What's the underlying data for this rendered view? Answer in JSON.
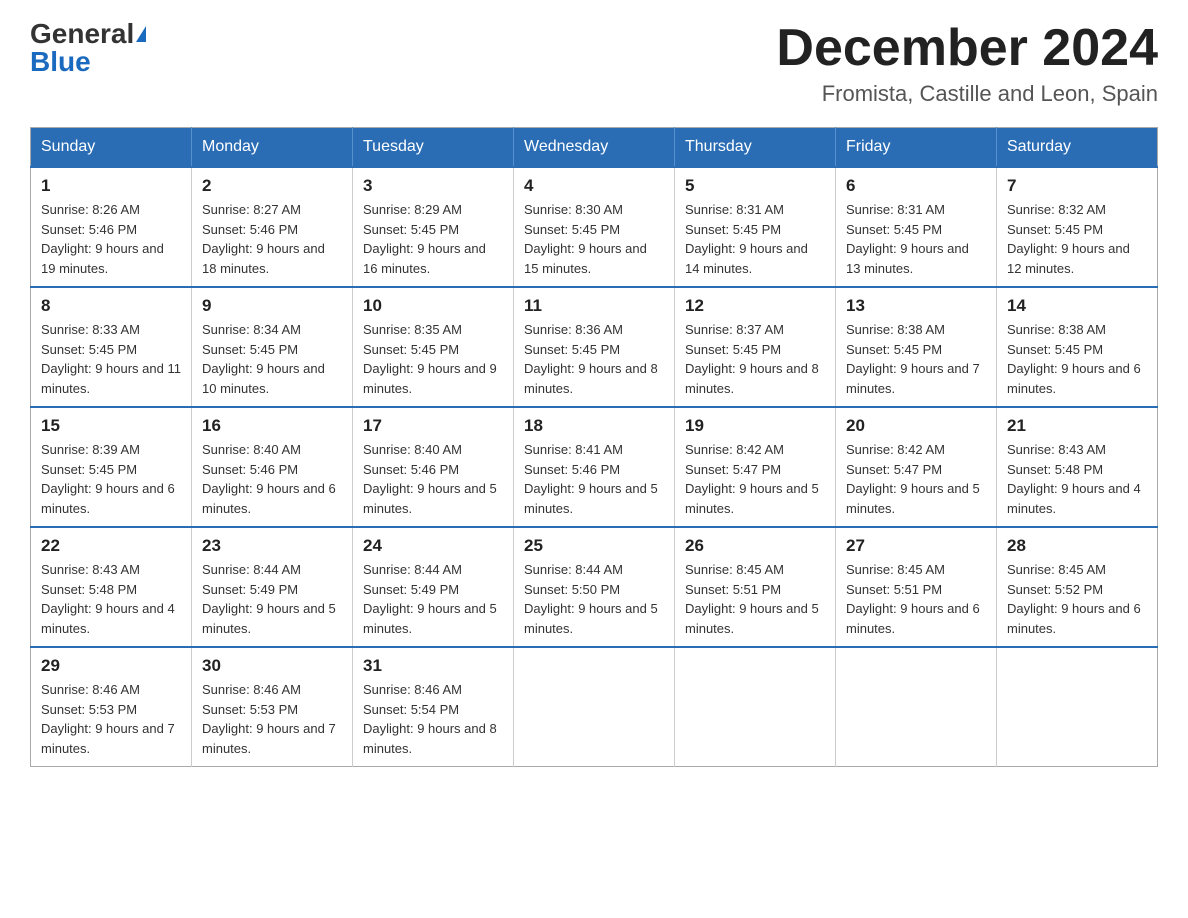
{
  "header": {
    "logo_general": "General",
    "logo_blue": "Blue",
    "month_year": "December 2024",
    "location": "Fromista, Castille and Leon, Spain"
  },
  "calendar": {
    "days_of_week": [
      "Sunday",
      "Monday",
      "Tuesday",
      "Wednesday",
      "Thursday",
      "Friday",
      "Saturday"
    ],
    "weeks": [
      [
        {
          "day": "1",
          "sunrise": "8:26 AM",
          "sunset": "5:46 PM",
          "daylight": "9 hours and 19 minutes."
        },
        {
          "day": "2",
          "sunrise": "8:27 AM",
          "sunset": "5:46 PM",
          "daylight": "9 hours and 18 minutes."
        },
        {
          "day": "3",
          "sunrise": "8:29 AM",
          "sunset": "5:45 PM",
          "daylight": "9 hours and 16 minutes."
        },
        {
          "day": "4",
          "sunrise": "8:30 AM",
          "sunset": "5:45 PM",
          "daylight": "9 hours and 15 minutes."
        },
        {
          "day": "5",
          "sunrise": "8:31 AM",
          "sunset": "5:45 PM",
          "daylight": "9 hours and 14 minutes."
        },
        {
          "day": "6",
          "sunrise": "8:31 AM",
          "sunset": "5:45 PM",
          "daylight": "9 hours and 13 minutes."
        },
        {
          "day": "7",
          "sunrise": "8:32 AM",
          "sunset": "5:45 PM",
          "daylight": "9 hours and 12 minutes."
        }
      ],
      [
        {
          "day": "8",
          "sunrise": "8:33 AM",
          "sunset": "5:45 PM",
          "daylight": "9 hours and 11 minutes."
        },
        {
          "day": "9",
          "sunrise": "8:34 AM",
          "sunset": "5:45 PM",
          "daylight": "9 hours and 10 minutes."
        },
        {
          "day": "10",
          "sunrise": "8:35 AM",
          "sunset": "5:45 PM",
          "daylight": "9 hours and 9 minutes."
        },
        {
          "day": "11",
          "sunrise": "8:36 AM",
          "sunset": "5:45 PM",
          "daylight": "9 hours and 8 minutes."
        },
        {
          "day": "12",
          "sunrise": "8:37 AM",
          "sunset": "5:45 PM",
          "daylight": "9 hours and 8 minutes."
        },
        {
          "day": "13",
          "sunrise": "8:38 AM",
          "sunset": "5:45 PM",
          "daylight": "9 hours and 7 minutes."
        },
        {
          "day": "14",
          "sunrise": "8:38 AM",
          "sunset": "5:45 PM",
          "daylight": "9 hours and 6 minutes."
        }
      ],
      [
        {
          "day": "15",
          "sunrise": "8:39 AM",
          "sunset": "5:45 PM",
          "daylight": "9 hours and 6 minutes."
        },
        {
          "day": "16",
          "sunrise": "8:40 AM",
          "sunset": "5:46 PM",
          "daylight": "9 hours and 6 minutes."
        },
        {
          "day": "17",
          "sunrise": "8:40 AM",
          "sunset": "5:46 PM",
          "daylight": "9 hours and 5 minutes."
        },
        {
          "day": "18",
          "sunrise": "8:41 AM",
          "sunset": "5:46 PM",
          "daylight": "9 hours and 5 minutes."
        },
        {
          "day": "19",
          "sunrise": "8:42 AM",
          "sunset": "5:47 PM",
          "daylight": "9 hours and 5 minutes."
        },
        {
          "day": "20",
          "sunrise": "8:42 AM",
          "sunset": "5:47 PM",
          "daylight": "9 hours and 5 minutes."
        },
        {
          "day": "21",
          "sunrise": "8:43 AM",
          "sunset": "5:48 PM",
          "daylight": "9 hours and 4 minutes."
        }
      ],
      [
        {
          "day": "22",
          "sunrise": "8:43 AM",
          "sunset": "5:48 PM",
          "daylight": "9 hours and 4 minutes."
        },
        {
          "day": "23",
          "sunrise": "8:44 AM",
          "sunset": "5:49 PM",
          "daylight": "9 hours and 5 minutes."
        },
        {
          "day": "24",
          "sunrise": "8:44 AM",
          "sunset": "5:49 PM",
          "daylight": "9 hours and 5 minutes."
        },
        {
          "day": "25",
          "sunrise": "8:44 AM",
          "sunset": "5:50 PM",
          "daylight": "9 hours and 5 minutes."
        },
        {
          "day": "26",
          "sunrise": "8:45 AM",
          "sunset": "5:51 PM",
          "daylight": "9 hours and 5 minutes."
        },
        {
          "day": "27",
          "sunrise": "8:45 AM",
          "sunset": "5:51 PM",
          "daylight": "9 hours and 6 minutes."
        },
        {
          "day": "28",
          "sunrise": "8:45 AM",
          "sunset": "5:52 PM",
          "daylight": "9 hours and 6 minutes."
        }
      ],
      [
        {
          "day": "29",
          "sunrise": "8:46 AM",
          "sunset": "5:53 PM",
          "daylight": "9 hours and 7 minutes."
        },
        {
          "day": "30",
          "sunrise": "8:46 AM",
          "sunset": "5:53 PM",
          "daylight": "9 hours and 7 minutes."
        },
        {
          "day": "31",
          "sunrise": "8:46 AM",
          "sunset": "5:54 PM",
          "daylight": "9 hours and 8 minutes."
        },
        null,
        null,
        null,
        null
      ]
    ]
  }
}
